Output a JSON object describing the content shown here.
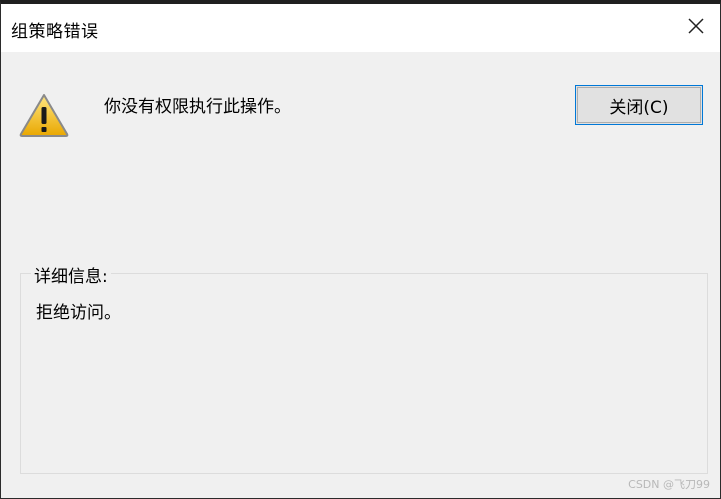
{
  "window": {
    "title": "组策略错误"
  },
  "dialog": {
    "message": "你没有权限执行此操作。",
    "close_button_label": "关闭(C)",
    "details_label": "详细信息:",
    "details_text": "拒绝访问。"
  },
  "icons": {
    "warning": "warning-icon",
    "close": "close-icon"
  },
  "watermark": "CSDN @飞刀99",
  "colors": {
    "focus_border": "#0078d7",
    "background": "#f0f0f0",
    "warning_fill": "#f4c400"
  }
}
